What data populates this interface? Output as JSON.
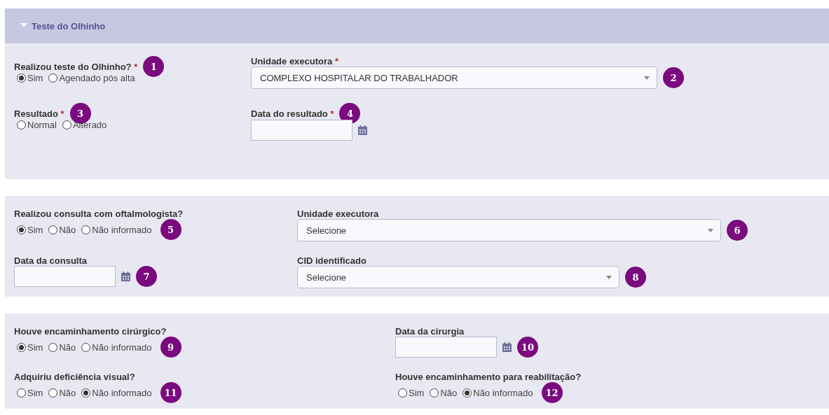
{
  "header": {
    "title": "Teste do Olhinho",
    "expanded": true
  },
  "sections": [
    {
      "fields": [
        {
          "kind": "radio",
          "label": "Realizou teste do Olhinho?",
          "mark": "*",
          "badge": "1",
          "options": [
            {
              "label": "Sim",
              "selected": true
            },
            {
              "label": "Agendado pós alta",
              "selected": false
            }
          ]
        },
        {
          "kind": "select",
          "label": "Unidade executora",
          "mark": "*",
          "badge": "2",
          "value": "COMPLEXO HOSPITALAR DO TRABALHADOR"
        },
        {
          "kind": "radio",
          "label": "Resultado",
          "mark": "*",
          "badge": "3",
          "options": [
            {
              "label": "Normal",
              "selected": false
            },
            {
              "label": "Alterado",
              "selected": false
            }
          ]
        },
        {
          "kind": "date",
          "label": "Data do resultado",
          "mark": "*",
          "badge": "4"
        }
      ]
    },
    {
      "fields": [
        {
          "kind": "radio",
          "label": "Realizou consulta com oftalmologista?",
          "badge": "5",
          "options": [
            {
              "label": "Sim",
              "selected": true
            },
            {
              "label": "Não",
              "selected": false
            },
            {
              "label": "Não informado",
              "selected": false
            }
          ]
        },
        {
          "kind": "select",
          "label": "Unidade executora",
          "badge": "6",
          "value": "Selecione"
        },
        {
          "kind": "date",
          "label": "Data da consulta",
          "badge": "7"
        },
        {
          "kind": "select",
          "label": "CID identificado",
          "badge": "8",
          "value": "Selecione"
        }
      ]
    },
    {
      "fields": [
        {
          "kind": "radio",
          "label": "Houve encaminhamento cirúrgico?",
          "badge": "9",
          "options": [
            {
              "label": "Sim",
              "selected": true
            },
            {
              "label": "Não",
              "selected": false
            },
            {
              "label": "Não informado",
              "selected": false
            }
          ]
        },
        {
          "kind": "date",
          "label": "Data da cirurgia",
          "badge": "10"
        },
        {
          "kind": "radio",
          "label": "Adquiriu deficiência visual?",
          "badge": "11",
          "options": [
            {
              "label": "Sim",
              "selected": false
            },
            {
              "label": "Não",
              "selected": false
            },
            {
              "label": "Não informado",
              "selected": true
            }
          ]
        },
        {
          "kind": "radio",
          "label": "Houve encaminhamento para reabilitação?",
          "badge": "12",
          "options": [
            {
              "label": "Sim",
              "selected": false
            },
            {
              "label": "Não",
              "selected": false
            },
            {
              "label": "Não informado",
              "selected": true
            }
          ]
        }
      ]
    }
  ]
}
